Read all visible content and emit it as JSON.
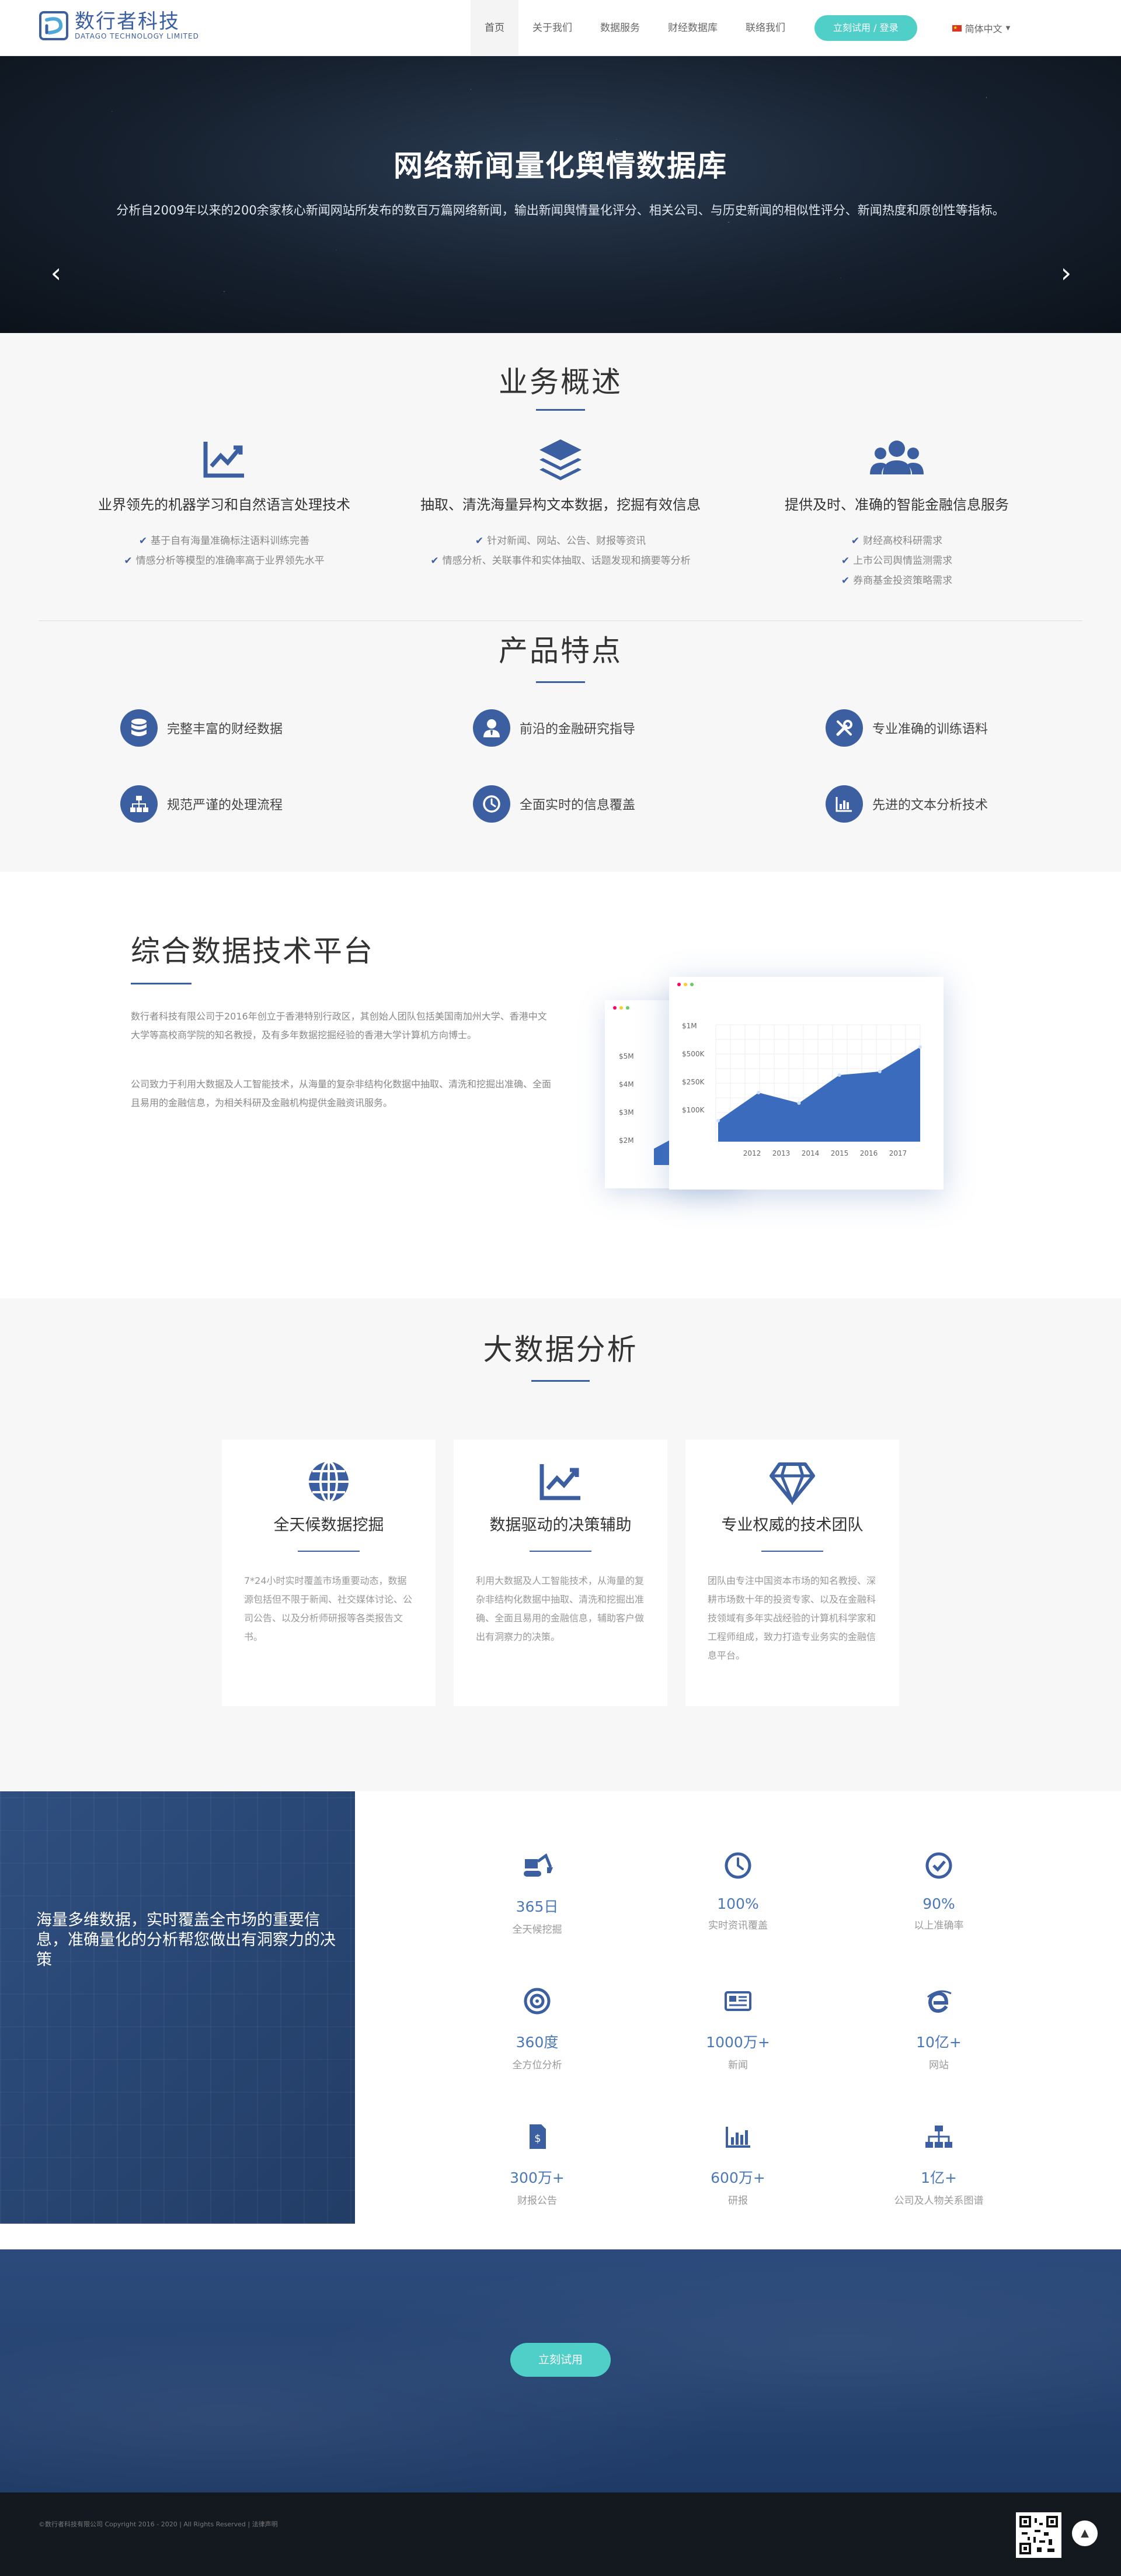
{
  "header": {
    "logo_cn": "数行者科技",
    "logo_en": "DATAGO TECHNOLOGY LIMITED",
    "nav": [
      "首页",
      "关于我们",
      "数据服务",
      "财经数据库",
      "联络我们"
    ],
    "cta": "立刻试用 / 登录",
    "language": "简体中文"
  },
  "hero": {
    "title": "网络新闻量化舆情数据库",
    "subtitle": "分析自2009年以来的200余家核心新闻网站所发布的数百万篇网络新闻，输出新闻舆情量化评分、相关公司、与历史新闻的相似性评分、新闻热度和原创性等指标。"
  },
  "overview": {
    "title": "业务概述",
    "columns": [
      {
        "title": "业界领先的机器学习和自然语言处理技术",
        "icon": "chart-line-icon",
        "bullets": [
          "基于自有海量准确标注语料训练完善",
          "情感分析等模型的准确率高于业界领先水平"
        ]
      },
      {
        "title": "抽取、清洗海量异构文本数据，挖掘有效信息",
        "icon": "layers-icon",
        "bullets": [
          "针对新闻、网站、公告、财报等资讯",
          "情感分析、关联事件和实体抽取、话题发现和摘要等分析"
        ]
      },
      {
        "title": "提供及时、准确的智能金融信息服务",
        "icon": "users-icon",
        "bullets": [
          "财经高校科研需求",
          "上市公司舆情监测需求",
          "券商基金投资策略需求"
        ]
      }
    ]
  },
  "features": {
    "title": "产品特点",
    "items": [
      {
        "label": "完整丰富的财经数据",
        "icon": "database-icon"
      },
      {
        "label": "前沿的金融研究指导",
        "icon": "user-tie-icon"
      },
      {
        "label": "专业准确的训练语料",
        "icon": "tools-icon"
      },
      {
        "label": "规范严谨的处理流程",
        "icon": "sitemap-icon"
      },
      {
        "label": "全面实时的信息覆盖",
        "icon": "clock-icon"
      },
      {
        "label": "先进的文本分析技术",
        "icon": "bar-chart-icon"
      }
    ]
  },
  "platform": {
    "title": "综合数据技术平台",
    "p1": "数行者科技有限公司于2016年创立于香港特别行政区，其创始人团队包括美国南加州大学、香港中文大学等高校商学院的知名教授，及有多年数据挖掘经验的香港大学计算机方向博士。",
    "p2": "公司致力于利用大数据及人工智能技术，从海量的复杂非结构化数据中抽取、清洗和挖掘出准确、全面且易用的金融信息，为相关科研及金融机构提供金融资讯服务。",
    "mock_back_ticks": [
      "$5M",
      "$4M",
      "$3M",
      "$2M"
    ],
    "mock_front_ticks": [
      "$1M",
      "$500K",
      "$250K",
      "$100K"
    ],
    "mock_years": [
      "2012",
      "2013",
      "2014",
      "2015",
      "2016",
      "2017"
    ]
  },
  "chart_data": {
    "type": "area",
    "x": [
      "2012",
      "2013",
      "2014",
      "2015",
      "2016",
      "2017"
    ],
    "series": [
      {
        "values": [
          60,
          140,
          110,
          190,
          200,
          270
        ]
      }
    ],
    "y_ticks": [
      "$1M",
      "$500K",
      "$250K",
      "$100K"
    ]
  },
  "bigdata": {
    "title": "大数据分析",
    "cards": [
      {
        "title": "全天候数据挖掘",
        "icon": "globe-icon",
        "text": "7*24小时实时覆盖市场重要动态，数据源包括但不限于新闻、社交媒体讨论、公司公告、以及分析师研报等各类报告文书。"
      },
      {
        "title": "数据驱动的决策辅助",
        "icon": "chart-line-icon",
        "text": "利用大数据及人工智能技术，从海量的复杂非结构化数据中抽取、清洗和挖掘出准确、全面且易用的金融信息，辅助客户做出有洞察力的决策。"
      },
      {
        "title": "专业权威的技术团队",
        "icon": "diamond-icon",
        "text": "团队由专注中国资本市场的知名教授、深耕市场数十年的投资专家、以及在金融科技领域有多年实战经验的计算机科学家和工程师组成，致力打造专业务实的金融信息平台。"
      }
    ]
  },
  "stats": {
    "intro": "海量多维数据，实时覆盖全市场的重要信息，准确量化的分析帮您做出有洞察力的决策",
    "items": [
      {
        "value": "365日",
        "label": "全天候挖掘",
        "icon": "excavator-icon"
      },
      {
        "value": "100%",
        "label": "实时资讯覆盖",
        "icon": "clock-icon"
      },
      {
        "value": "90%",
        "label": "以上准确率",
        "icon": "check-circle-icon"
      },
      {
        "value": "360度",
        "label": "全方位分析",
        "icon": "target-icon"
      },
      {
        "value": "1000万+",
        "label": "新闻",
        "icon": "newspaper-icon"
      },
      {
        "value": "10亿+",
        "label": "网站",
        "icon": "browser-icon"
      },
      {
        "value": "300万+",
        "label": "财报公告",
        "icon": "invoice-icon"
      },
      {
        "value": "600万+",
        "label": "研报",
        "icon": "bar-chart-icon"
      },
      {
        "value": "1亿+",
        "label": "公司及人物关系图谱",
        "icon": "sitemap-icon"
      }
    ]
  },
  "cta": {
    "label": "立刻试用"
  },
  "footer": {
    "text": "©数行者科技有限公司 Copyright 2016 - 2020 | All Rights Reserved | 法律声明"
  },
  "colors": {
    "brand": "#3b5fa0",
    "accent": "#4fcfc8",
    "footer": "#14181f"
  }
}
